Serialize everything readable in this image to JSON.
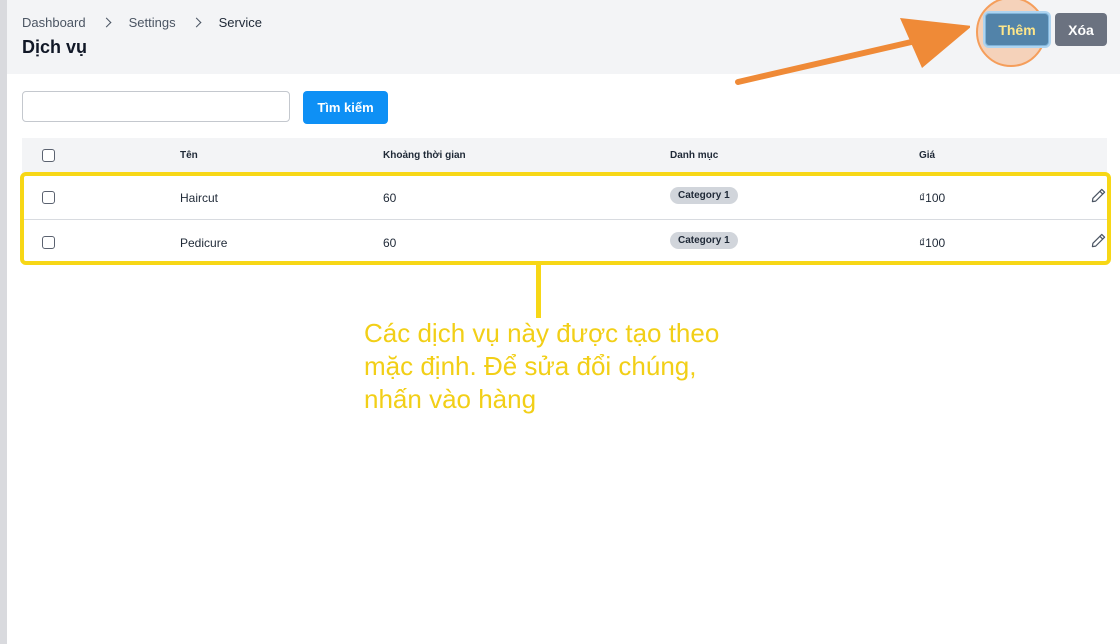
{
  "breadcrumb": [
    "Dashboard",
    "Settings",
    "Service"
  ],
  "page_title": "Dịch vụ",
  "actions": {
    "add_label": "Thêm",
    "delete_label": "Xóa"
  },
  "search": {
    "value": "",
    "placeholder": "",
    "button_label": "Tìm kiếm"
  },
  "table": {
    "columns": [
      "Tên",
      "Khoảng thời gian",
      "Danh mục",
      "Giá"
    ],
    "rows": [
      {
        "name": "Haircut",
        "duration": "60",
        "category": "Category 1",
        "price": "₫100"
      },
      {
        "name": "Pedicure",
        "duration": "60",
        "category": "Category 1",
        "price": "₫100"
      }
    ]
  },
  "annotation": {
    "lines": [
      "Các dịch vụ này được tạo theo",
      "mặc định. Để sửa đổi chúng,",
      "nhấn vào hàng"
    ]
  },
  "colors": {
    "header_bg": "#f3f4f6",
    "primary": "#0e90f5",
    "add_button": "#5283a9",
    "delete_button": "#6b7280",
    "callout_yellow": "#f7d716",
    "arrow_orange": "#ef8a37"
  },
  "icons": [
    "chevron-right-icon",
    "edit-pencil-icon"
  ]
}
